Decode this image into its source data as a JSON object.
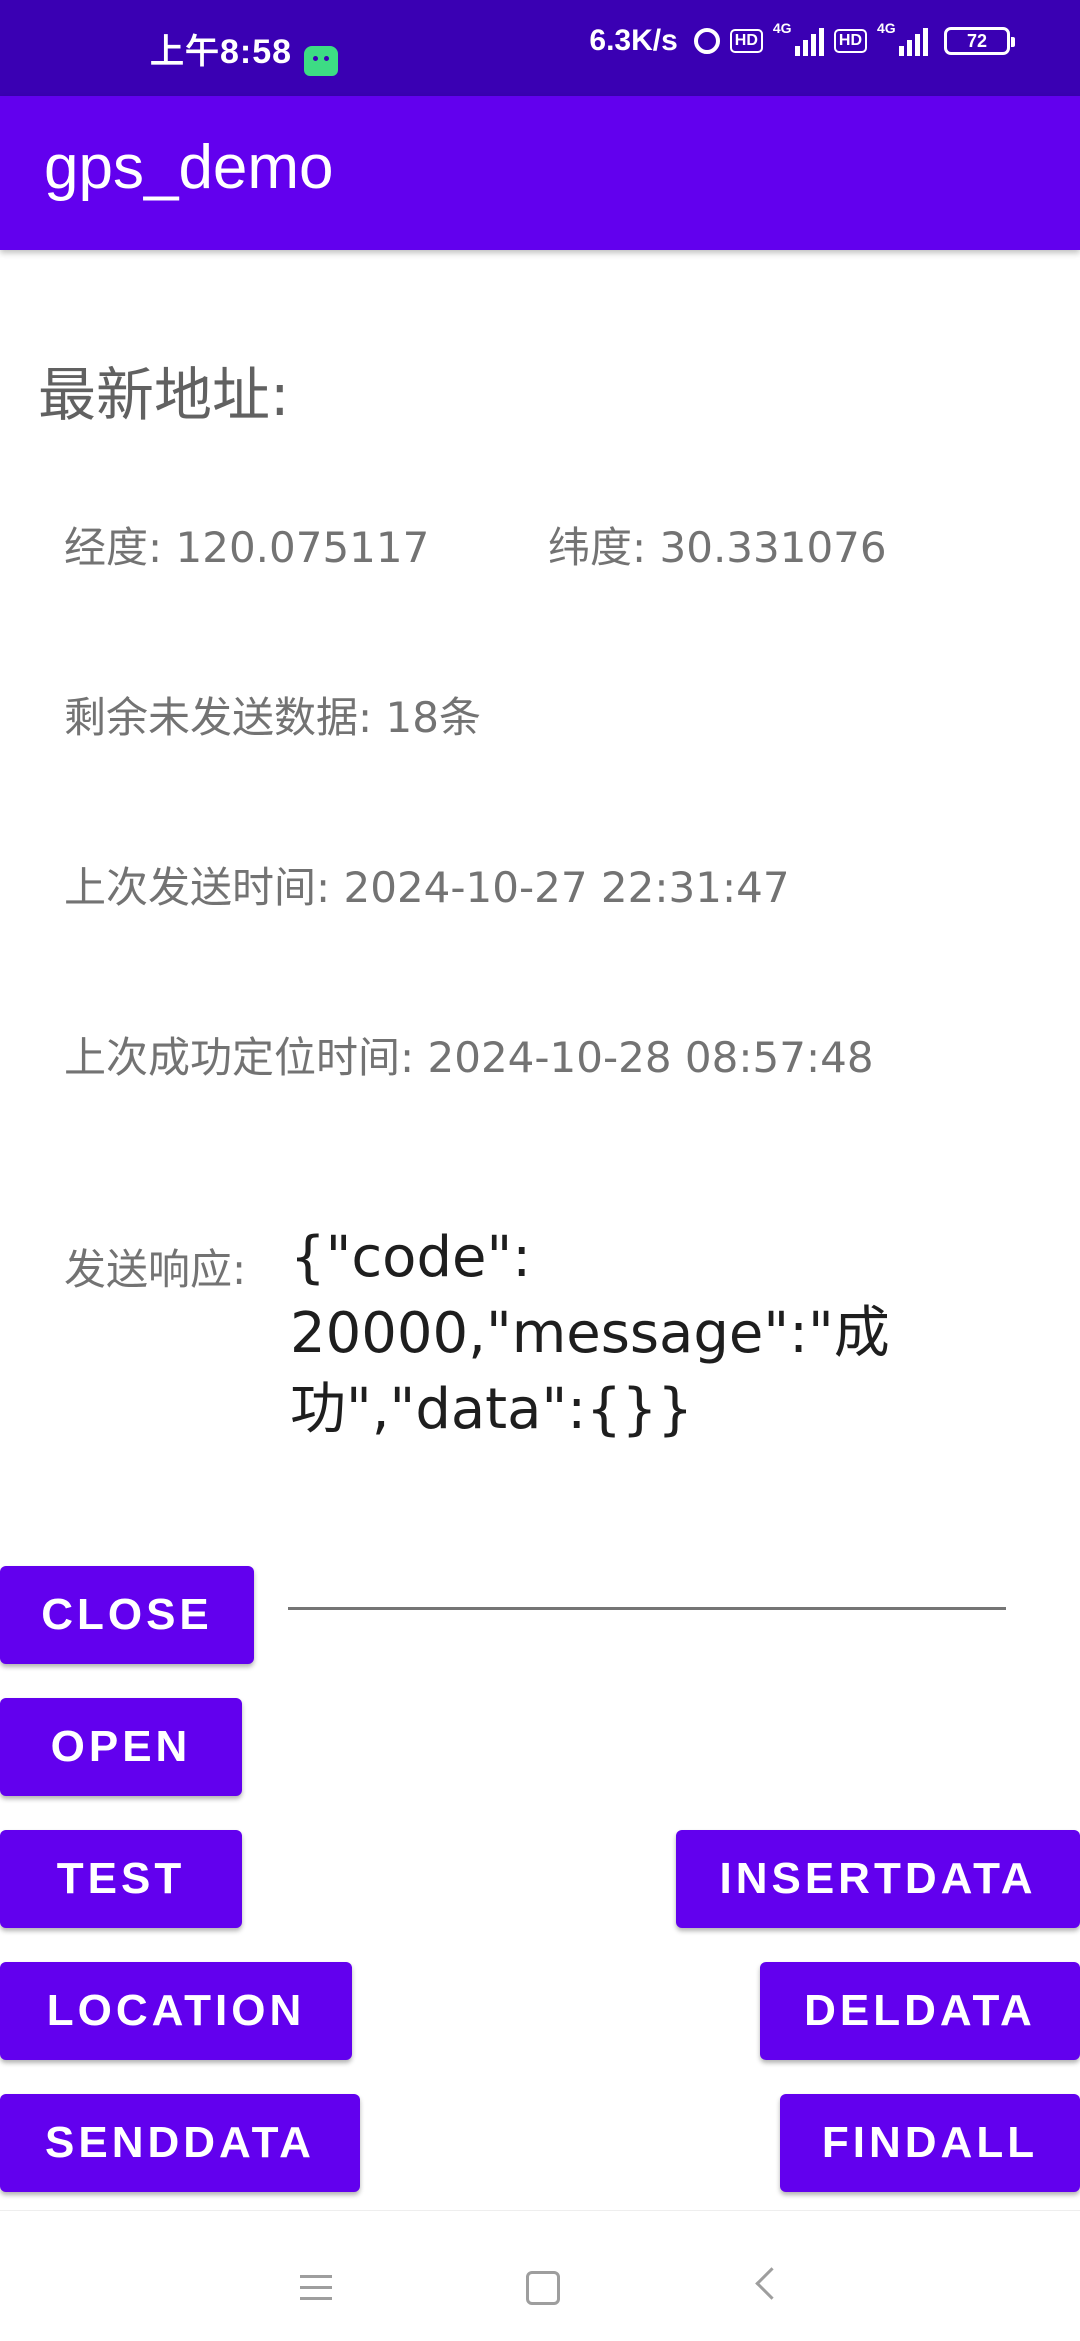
{
  "status_bar": {
    "time": "上午8:58",
    "speed": "6.3K/s",
    "hd_label": "HD",
    "net_label": "4G",
    "battery": "72"
  },
  "app": {
    "title": "gps_demo",
    "accent_color": "#6200ee"
  },
  "content": {
    "section_title": "最新地址:",
    "longitude": "经度: 120.075117",
    "latitude": "纬度: 30.331076",
    "remaining": "剩余未发送数据: 18条",
    "last_send": "上次发送时间: 2024-10-27 22:31:47",
    "last_location": "上次成功定位时间: 2024-10-28 08:57:48",
    "response_label": "发送响应:",
    "response_value": "{\"code\": 20000,\"message\":\"成功\",\"data\":{}}"
  },
  "buttons": {
    "close": "CLOSE",
    "open": "OPEN",
    "test": "TEST",
    "insertdata": "INSERTDATA",
    "location": "LOCATION",
    "deldata": "DELDATA",
    "senddata": "SENDDATA",
    "findall": "FINDALL"
  },
  "input": {
    "value": ""
  },
  "nav": {
    "icons": [
      "menu-icon",
      "home-icon",
      "back-icon"
    ]
  }
}
